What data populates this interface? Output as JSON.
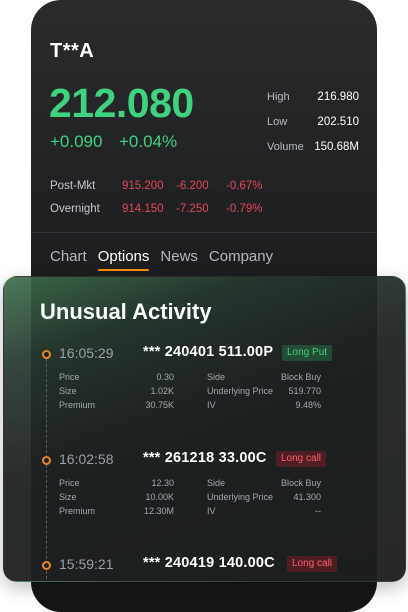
{
  "quote": {
    "ticker": "T**A",
    "price": "212.080",
    "change_abs": "+0.090",
    "change_pct": "+0.04%",
    "stats": [
      {
        "label": "High",
        "value": "216.980"
      },
      {
        "label": "Low",
        "value": "202.510"
      },
      {
        "label": "Volume",
        "value": "150.68M"
      }
    ],
    "extended": [
      {
        "label": "Post-Mkt",
        "price": "915.200",
        "change": "-6.200",
        "pct": "-0.67%"
      },
      {
        "label": "Overnight",
        "price": "914.150",
        "change": "-7.250",
        "pct": "-0.79%"
      }
    ]
  },
  "tabs": [
    {
      "label": "Chart",
      "active": false
    },
    {
      "label": "Options",
      "active": true
    },
    {
      "label": "News",
      "active": false
    },
    {
      "label": "Company",
      "active": false
    }
  ],
  "activity": {
    "title": "Unusual Activity",
    "entries": [
      {
        "time": "16:05:29",
        "contract": "*** 240401 511.00P",
        "badge": "Long Put",
        "badge_type": "put",
        "details": [
          {
            "l1": "Price",
            "v1": "0.30",
            "l2": "Side",
            "v2": "Block Buy"
          },
          {
            "l1": "Size",
            "v1": "1.02K",
            "l2": "Underlying Price",
            "v2": "519.770"
          },
          {
            "l1": "Premium",
            "v1": "30.75K",
            "l2": "IV",
            "v2": "9.48%"
          }
        ]
      },
      {
        "time": "16:02:58",
        "contract": "*** 261218 33.00C",
        "badge": "Long call",
        "badge_type": "call",
        "details": [
          {
            "l1": "Price",
            "v1": "12.30",
            "l2": "Side",
            "v2": "Block Buy"
          },
          {
            "l1": "Size",
            "v1": "10.00K",
            "l2": "Underlying Price",
            "v2": "41.300"
          },
          {
            "l1": "Premium",
            "v1": "12.30M",
            "l2": "IV",
            "v2": "--"
          }
        ]
      },
      {
        "time": "15:59:21",
        "contract": "*** 240419 140.00C",
        "badge": "Long call",
        "badge_type": "call",
        "details": []
      }
    ]
  },
  "colors": {
    "up": "#3fd27f",
    "down": "#e5475c",
    "accent": "#ff8a00"
  }
}
